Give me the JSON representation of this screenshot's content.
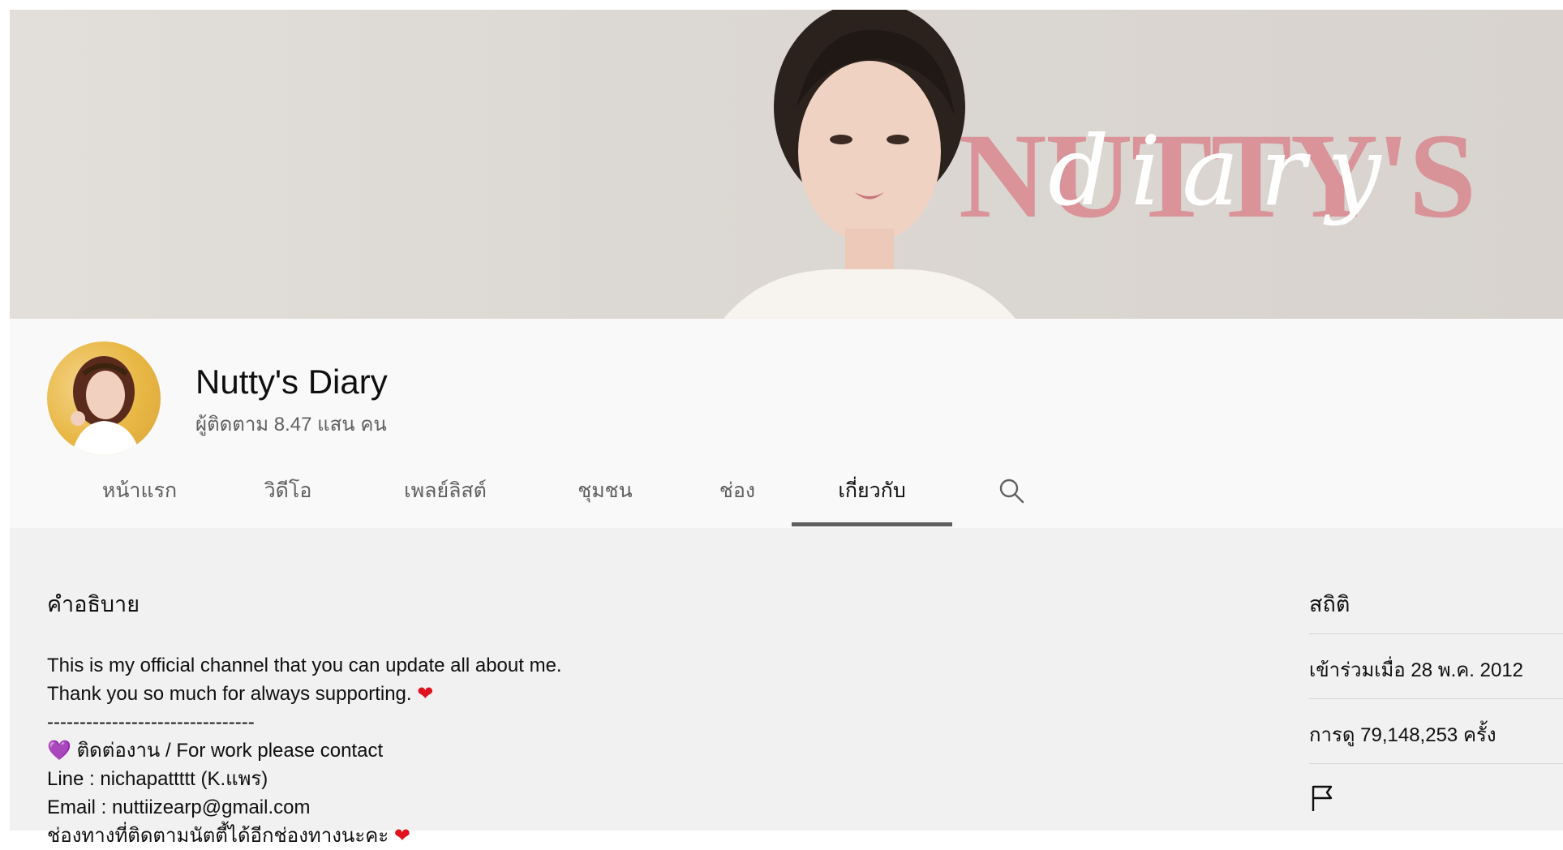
{
  "banner": {
    "logo_word": "NUTTY'S",
    "logo_script": "diary"
  },
  "channel": {
    "name": "Nutty's Diary",
    "subscribers": "ผู้ติดตาม 8.47 แสน คน"
  },
  "tabs": [
    {
      "label": "หน้าแรก",
      "active": false
    },
    {
      "label": "วิดีโอ",
      "active": false
    },
    {
      "label": "เพลย์ลิสต์",
      "active": false
    },
    {
      "label": "ชุมชน",
      "active": false
    },
    {
      "label": "ช่อง",
      "active": false
    },
    {
      "label": "เกี่ยวกับ",
      "active": true
    }
  ],
  "description": {
    "title": "คำอธิบาย",
    "lines": [
      "This is my official channel that you can update all about me.",
      "Thank you so much for always supporting.",
      "--------------------------------",
      "ติดต่องาน / For work please contact",
      "Line : nichapattttt (K.แพร)",
      "Email : nuttiizearp@gmail.com",
      "ช่องทางที่ติดตามนัตตี้ได้อีกช่องทางนะคะ"
    ],
    "heart_emoji": "❤",
    "purple_heart_emoji": "💜"
  },
  "stats": {
    "title": "สถิติ",
    "joined": "เข้าร่วมเมื่อ 28 พ.ค. 2012",
    "views": "การดู 79,148,253 ครั้ง"
  },
  "colors": {
    "banner_bg": "#dcd8d3",
    "logo_pink": "#d98e95",
    "header_bg": "#f9f9f9",
    "content_bg": "#f1f1f1",
    "muted_text": "#606060"
  },
  "icons": {
    "search": "search-icon",
    "flag": "flag-icon"
  }
}
